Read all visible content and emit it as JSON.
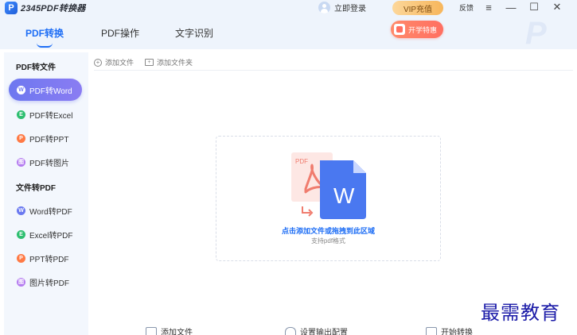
{
  "app": {
    "logo_mark": "P",
    "title": "2345PDF转换器"
  },
  "header": {
    "login_label": "立即登录",
    "vip_label": "VIP充值",
    "feedback_label": "反馈",
    "menu_icon": "≡",
    "minimize_icon": "—",
    "maximize_icon": "☐",
    "close_icon": "✕"
  },
  "tabs": [
    {
      "label": "PDF转换",
      "active": true
    },
    {
      "label": "PDF操作",
      "active": false
    },
    {
      "label": "文字识别",
      "active": false
    }
  ],
  "promo": {
    "label": "开学特惠"
  },
  "sidebar": {
    "section1": "PDF转文件",
    "items1": [
      {
        "label": "PDF转Word",
        "icon": "W",
        "color": "#ffffff"
      },
      {
        "label": "PDF转Excel",
        "icon": "E",
        "color": "#2fbf71"
      },
      {
        "label": "PDF转PPT",
        "icon": "P",
        "color": "#ff7a45"
      },
      {
        "label": "PDF转图片",
        "icon": "图",
        "color": "#b57cf0"
      }
    ],
    "section2": "文件转PDF",
    "items2": [
      {
        "label": "Word转PDF",
        "icon": "W",
        "color": "#6a79f0"
      },
      {
        "label": "Excel转PDF",
        "icon": "E",
        "color": "#2fbf71"
      },
      {
        "label": "PPT转PDF",
        "icon": "P",
        "color": "#ff7a45"
      },
      {
        "label": "图片转PDF",
        "icon": "图",
        "color": "#b57cf0"
      }
    ]
  },
  "toolbar": {
    "add_file": "添加文件",
    "add_folder": "添加文件夹"
  },
  "dropzone": {
    "pdf_label": "PDF",
    "word_letter": "W",
    "title": "点击添加文件或拖拽到此区域",
    "subtitle": "支持pdf格式"
  },
  "bottom": {
    "add_file": "添加文件",
    "output_config": "设置输出配置",
    "start": "开始转换"
  },
  "watermark": "最需教育"
}
